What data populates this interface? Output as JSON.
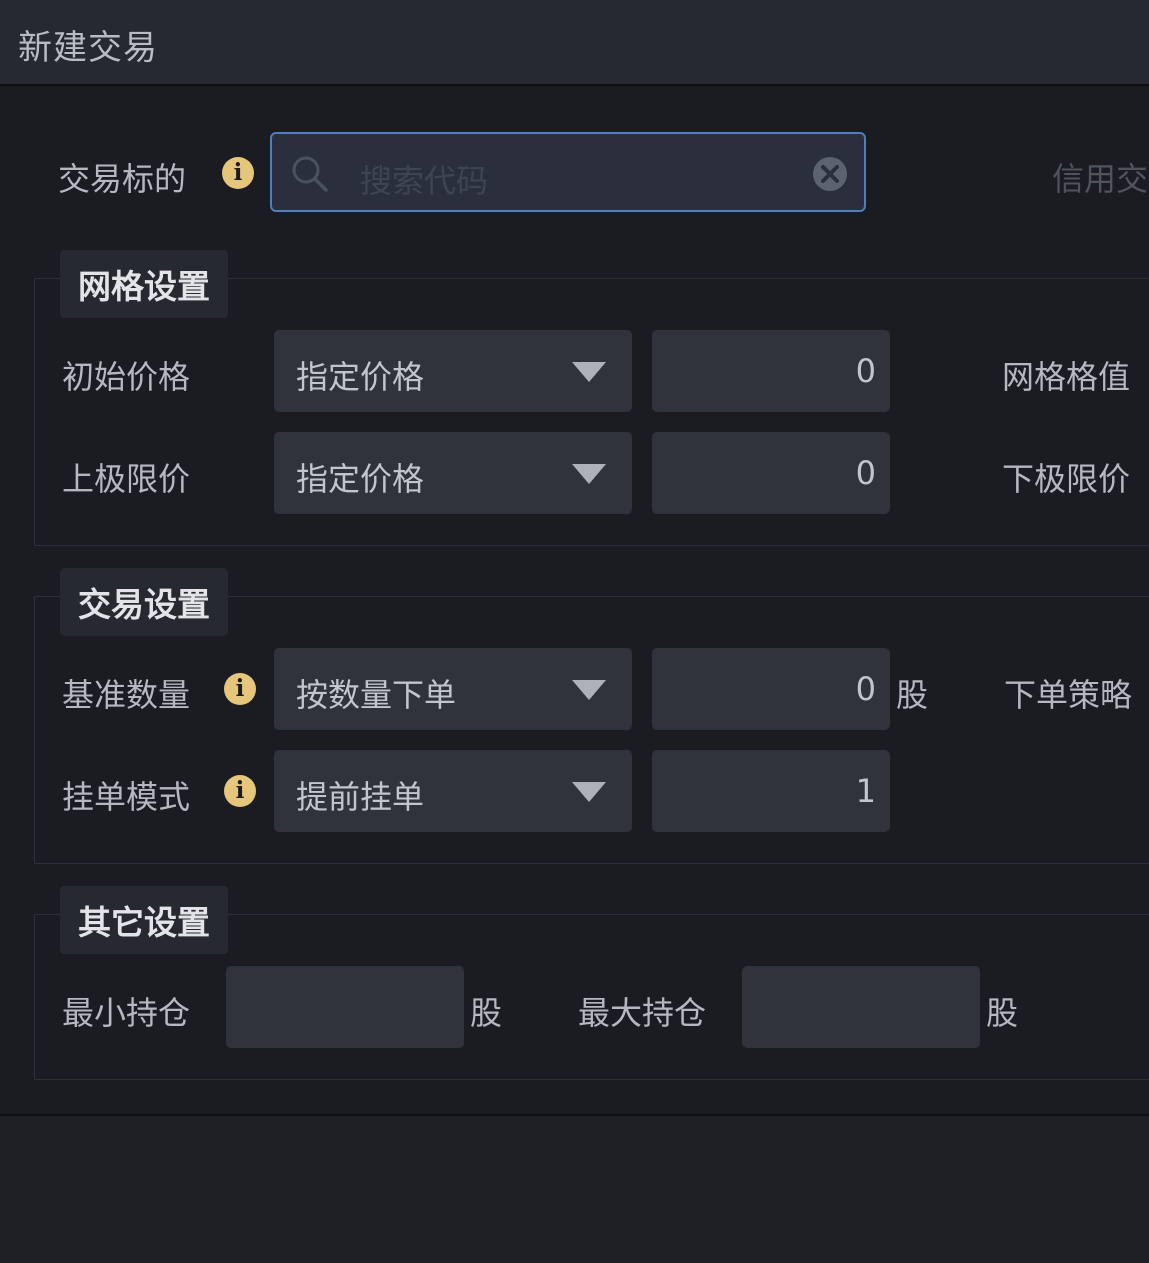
{
  "window": {
    "title": "新建交易"
  },
  "target": {
    "label": "交易标的",
    "search_placeholder": "搜索代码",
    "right_label": "信用交"
  },
  "grid_settings": {
    "section_title": "网格设置",
    "initial_price": {
      "label": "初始价格",
      "mode": "指定价格",
      "value": "0"
    },
    "upper_limit": {
      "label": "上极限价",
      "mode": "指定价格",
      "value": "0"
    },
    "grid_value_label": "网格格值",
    "lower_limit_label": "下极限价"
  },
  "trade_settings": {
    "section_title": "交易设置",
    "base_quantity": {
      "label": "基准数量",
      "mode": "按数量下单",
      "value": "0",
      "unit": "股"
    },
    "order_strategy_label": "下单策略",
    "order_mode": {
      "label": "挂单模式",
      "mode": "提前挂单",
      "value": "1"
    }
  },
  "other_settings": {
    "section_title": "其它设置",
    "min_position": {
      "label": "最小持仓",
      "value": "",
      "unit": "股"
    },
    "max_position": {
      "label": "最大持仓",
      "value": "",
      "unit": "股"
    }
  },
  "colors": {
    "background": "#1a1c21",
    "titlebar": "#262931",
    "input_bg": "#30333b",
    "focus_border": "#4d7fbf",
    "info_icon": "#e6c67a"
  },
  "icons": [
    "search-icon",
    "clear-icon",
    "info-icon",
    "chevron-down-icon"
  ]
}
